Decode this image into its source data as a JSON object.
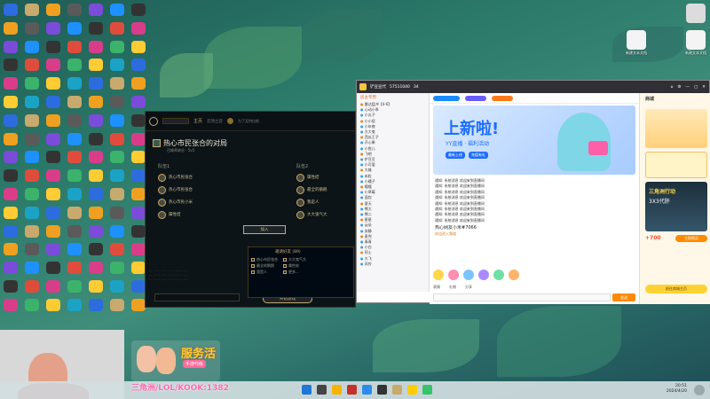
{
  "desktop": {
    "right_icons": [
      {
        "label": "新建文本文档"
      },
      {
        "label": "新建文本文档"
      }
    ]
  },
  "league_client": {
    "nav": {
      "home": "主页",
      "shop_label": "云顶之弈",
      "tft_label": "为了瓦特拉斯"
    },
    "room_title": "热心市民张合的对局",
    "room_sub": "召唤师峡谷 · 5v5",
    "team1_label": "队伍1",
    "team2_label": "队伍2",
    "team1": [
      {
        "name": "热心市民张合",
        "tag": "级别"
      },
      {
        "name": "热心市民张合",
        "tag": "组队中"
      },
      {
        "name": "热心市民小米",
        "tag": "等级"
      },
      {
        "name": "属性结",
        "tag": ""
      }
    ],
    "team2": [
      {
        "name": "属性结"
      },
      {
        "name": "最全的鹅鹅"
      },
      {
        "name": "我是人"
      },
      {
        "name": "大大鬼气大"
      }
    ],
    "join_button": "加入",
    "invite_button": "邀请",
    "start_button": "开始游戏",
    "spectate_label": "观战",
    "menu_title": "邀请好友 (89)",
    "menu_items": [
      "热心市民张合",
      "最全的鹅鹅",
      "我是人",
      "大大鬼气大",
      "属性结",
      "更多..."
    ]
  },
  "yy_window": {
    "title": "铲豆豆代",
    "room_id": "57511040",
    "online": "34",
    "left_header": "房主专用",
    "users": [
      "雷达猛冲【4-6】",
      "心动小乖",
      "小丸子",
      "小小屁",
      "小年夜",
      "大大鬼",
      "西瓜王子",
      "开心果",
      "小鱼儿",
      "飞吧",
      "铲豆豆",
      "小可爱",
      "大雄",
      "米粒",
      "小橘子",
      "嘻嘻",
      "小草莓",
      "面包",
      "夏天",
      "熊大",
      "熊二",
      "星星",
      "云朵",
      "安静",
      "麦兜",
      "青青",
      "小白",
      "阿土",
      "大飞",
      "风铃"
    ],
    "banner_headline": "上新啦!",
    "banner_sub": "YY直播 · 福利活动",
    "banner_tags": [
      "最新上线",
      "充值有礼"
    ],
    "chat": [
      "通知: 系统消息 欢迎来到直播间",
      "通知: 系统消息 欢迎来到直播间",
      "通知: 系统消息 欢迎来到直播间",
      "通知: 系统消息 欢迎来到直播间",
      "通知: 系统消息 欢迎来到直播间",
      "通知: 系统消息 欢迎来到直播间",
      "通知: 系统消息 欢迎来到直播间",
      "通知: 系统消息 欢迎来到直播间"
    ],
    "sys_msg": "热心网友小米#7066",
    "sys_msg2": "欢迎进入频道",
    "toolbar": [
      "表情",
      "礼物",
      "分享",
      "发送"
    ],
    "right_title": "商城",
    "right_promo": "三角洲行动",
    "right_promo2": "3X3代肝",
    "right_price": "+700",
    "right_cta": "前往商城主页",
    "right_btn": "立即购买"
  },
  "overlay": {
    "service_text": "服务活",
    "service_sub": "手游代练",
    "watermark": "三角洲/LOL/KOOK:1382"
  },
  "clock": {
    "time": "20:51",
    "date": "2024/4/20"
  },
  "colors": {
    "lol_gold": "#c8aa6e",
    "yy_orange": "#ff8a00",
    "taskbar": "#d2dee1"
  }
}
